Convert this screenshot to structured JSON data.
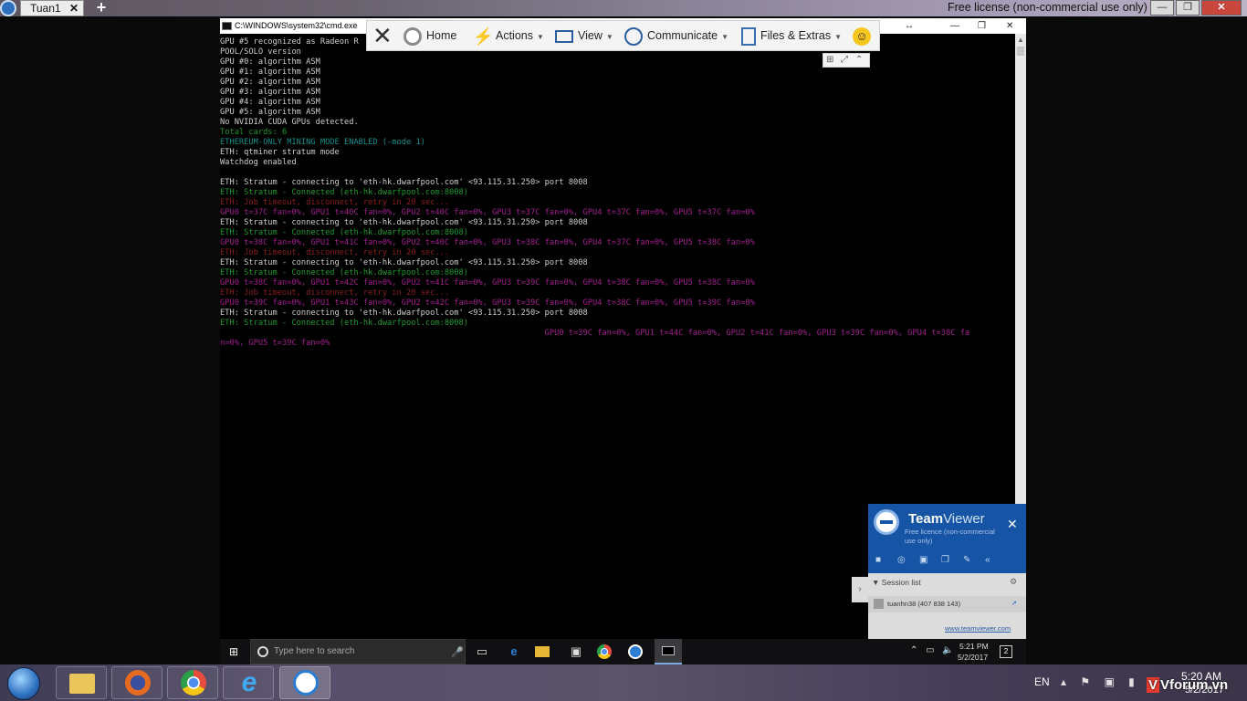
{
  "outer_bar": {
    "tab_label": "Tuan1",
    "tab_close": "✕",
    "new_tab": "+",
    "license": "Free license (non-commercial use only)",
    "min": "—",
    "max": "❐",
    "close": "✕"
  },
  "cmd": {
    "title": "C:\\WINDOWS\\system32\\cmd.exe",
    "resize": "↔",
    "min": "—",
    "restore": "❐",
    "close": "✕",
    "lines": [
      {
        "text": "GPU #5 recognized as Radeon R",
        "color": "white"
      },
      {
        "text": "POOL/SOLO version",
        "color": "white"
      },
      {
        "text": "GPU #0: algorithm ASM",
        "color": "white"
      },
      {
        "text": "GPU #1: algorithm ASM",
        "color": "white"
      },
      {
        "text": "GPU #2: algorithm ASM",
        "color": "white"
      },
      {
        "text": "GPU #3: algorithm ASM",
        "color": "white"
      },
      {
        "text": "GPU #4: algorithm ASM",
        "color": "white"
      },
      {
        "text": "GPU #5: algorithm ASM",
        "color": "white"
      },
      {
        "text": "No NVIDIA CUDA GPUs detected.",
        "color": "white"
      },
      {
        "text": "Total cards: 6",
        "color": "green"
      },
      {
        "text": "ETHEREUM-ONLY MINING MODE ENABLED (-mode 1)",
        "color": "cyan"
      },
      {
        "text": "ETH: qtminer stratum mode",
        "color": "white"
      },
      {
        "text": "Watchdog enabled",
        "color": "white"
      },
      {
        "text": "",
        "color": "white"
      },
      {
        "text": "ETH: Stratum - connecting to 'eth-hk.dwarfpool.com' <93.115.31.250> port 8008",
        "color": "white"
      },
      {
        "text": "ETH: Stratum - Connected (eth-hk.dwarfpool.com:8008)",
        "color": "green"
      },
      {
        "text": "ETH: Job timeout, disconnect, retry in 20 sec...",
        "color": "red"
      },
      {
        "text": "GPU0 t=37C fan=0%, GPU1 t=40C fan=0%, GPU2 t=40C fan=0%, GPU3 t=37C fan=0%, GPU4 t=37C fan=0%, GPU5 t=37C fan=0%",
        "color": "magenta"
      },
      {
        "text": "ETH: Stratum - connecting to 'eth-hk.dwarfpool.com' <93.115.31.250> port 8008",
        "color": "white"
      },
      {
        "text": "ETH: Stratum - Connected (eth-hk.dwarfpool.com:8008)",
        "color": "green"
      },
      {
        "text": "GPU0 t=38C fan=0%, GPU1 t=41C fan=0%, GPU2 t=40C fan=0%, GPU3 t=38C fan=0%, GPU4 t=37C fan=0%, GPU5 t=38C fan=0%",
        "color": "magenta"
      },
      {
        "text": "ETH: Job timeout, disconnect, retry in 20 sec...",
        "color": "red"
      },
      {
        "text": "ETH: Stratum - connecting to 'eth-hk.dwarfpool.com' <93.115.31.250> port 8008",
        "color": "white"
      },
      {
        "text": "ETH: Stratum - Connected (eth-hk.dwarfpool.com:8008)",
        "color": "green"
      },
      {
        "text": "GPU0 t=38C fan=0%, GPU1 t=42C fan=0%, GPU2 t=41C fan=0%, GPU3 t=39C fan=0%, GPU4 t=38C fan=0%, GPU5 t=38C fan=0%",
        "color": "magenta"
      },
      {
        "text": "ETH: Job timeout, disconnect, retry in 20 sec...",
        "color": "red"
      },
      {
        "text": "GPU0 t=39C fan=0%, GPU1 t=43C fan=0%, GPU2 t=42C fan=0%, GPU3 t=39C fan=0%, GPU4 t=38C fan=0%, GPU5 t=39C fan=0%",
        "color": "magenta"
      },
      {
        "text": "ETH: Stratum - connecting to 'eth-hk.dwarfpool.com' <93.115.31.250> port 8008",
        "color": "white"
      },
      {
        "text": "ETH: Stratum - Connected (eth-hk.dwarfpool.com:8008)",
        "color": "green"
      },
      {
        "text": "                                                                    GPU0 t=39C fan=0%, GPU1 t=44C fan=0%, GPU2 t=41C fan=0%, GPU3 t=39C fan=0%, GPU4 t=38C fa",
        "color": "magenta"
      },
      {
        "text": "n=0%, GPU5 t=39C fan=0%",
        "color": "magenta"
      }
    ]
  },
  "toolbar": {
    "close": "✕",
    "home": "Home",
    "actions": "Actions",
    "view": "View",
    "communicate": "Communicate",
    "files": "Files & Extras",
    "caret": "▼",
    "smiley": "☺",
    "mini_grid": "⊞",
    "mini_expand": "⤢",
    "mini_collapse": "⌃"
  },
  "remote_taskbar": {
    "search_placeholder": "Type here to search",
    "tray_icons": "⌃ ▭ 🔈",
    "time": "5:21 PM",
    "date": "5/2/2017",
    "notifications": "2"
  },
  "teamviewer_panel": {
    "name_bold": "Team",
    "name_light": "Viewer",
    "subtitle": "Free licence (non-commercial use only)",
    "close": "✕",
    "icons": [
      "■",
      "◎",
      "▣",
      "❐",
      "✎",
      "«"
    ],
    "session_header": "▼ Session list",
    "session_gear": "⚙",
    "session_user": "tuanhn38 (407 838 143)",
    "link": "www.teamviewer.com",
    "expand_arrow": "›"
  },
  "local_taskbar": {
    "lang": "EN",
    "tray_icons": "▴ ⚑ ▣ ▮",
    "time": "5:20 AM",
    "date": "5/2/2017",
    "watermark": "Vforum.vn"
  },
  "colors": {
    "console_bg": "#000000",
    "green": "#1f9a2e",
    "cyan": "#1c8e8a",
    "red": "#8a1f1f",
    "magenta": "#a21f8e",
    "teamviewer_blue": "#1655a6"
  }
}
